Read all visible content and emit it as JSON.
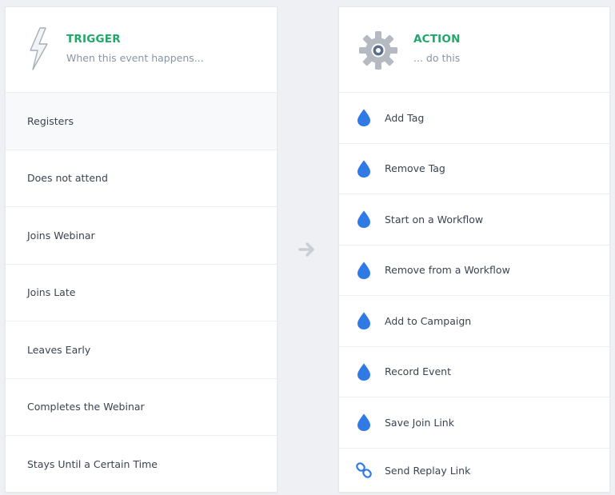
{
  "trigger": {
    "title": "TRIGGER",
    "subtitle": "When this event happens...",
    "icon": "lightning-bolt-icon",
    "items": [
      {
        "label": "Registers",
        "selected": true
      },
      {
        "label": "Does not attend",
        "selected": false
      },
      {
        "label": "Joins Webinar",
        "selected": false
      },
      {
        "label": "Joins Late",
        "selected": false
      },
      {
        "label": "Leaves Early",
        "selected": false
      },
      {
        "label": "Completes the Webinar",
        "selected": false
      },
      {
        "label": "Stays Until a Certain Time",
        "selected": false
      }
    ]
  },
  "action": {
    "title": "ACTION",
    "subtitle": "... do this",
    "icon": "gear-icon",
    "items": [
      {
        "label": "Add Tag",
        "icon": "drop-icon"
      },
      {
        "label": "Remove Tag",
        "icon": "drop-icon"
      },
      {
        "label": "Start on a Workflow",
        "icon": "drop-icon"
      },
      {
        "label": "Remove from a Workflow",
        "icon": "drop-icon"
      },
      {
        "label": "Add to Campaign",
        "icon": "drop-icon"
      },
      {
        "label": "Record Event",
        "icon": "drop-icon"
      },
      {
        "label": "Save Join Link",
        "icon": "drop-icon"
      },
      {
        "label": "Send Replay Link",
        "icon": "link-icon"
      }
    ]
  },
  "colors": {
    "accent_green": "#1fa86a",
    "drop_blue": "#2f7ae5",
    "arrow_gray": "#c9ced6"
  }
}
